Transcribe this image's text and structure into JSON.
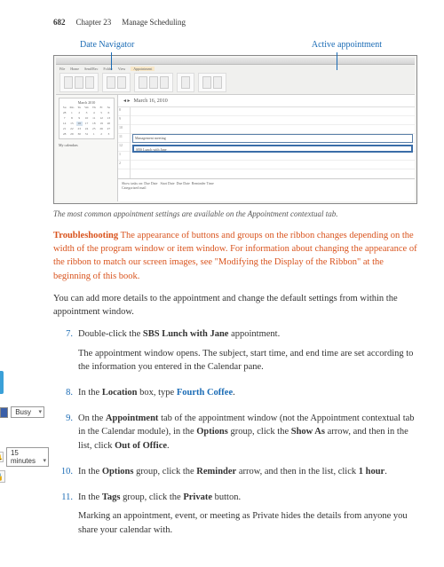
{
  "header": {
    "page_number": "682",
    "chapter": "Chapter 23",
    "title": "Manage Scheduling"
  },
  "callouts": {
    "left": "Date Navigator",
    "right": "Active appointment"
  },
  "screenshot": {
    "date_header": "March 16, 2010",
    "cal_month": "March 2010",
    "cal_days": [
      "Su",
      "Mo",
      "Tu",
      "We",
      "Th",
      "Fr",
      "Sa"
    ],
    "cal_nums": [
      "28",
      "1",
      "2",
      "3",
      "4",
      "5",
      "6",
      "7",
      "8",
      "9",
      "10",
      "11",
      "12",
      "13",
      "14",
      "15",
      "16",
      "17",
      "18",
      "19",
      "20",
      "21",
      "22",
      "23",
      "24",
      "25",
      "26",
      "27",
      "28",
      "29",
      "30",
      "31",
      "1",
      "2",
      "3"
    ],
    "my_calendars": "My calendars",
    "hours": [
      "8",
      "9",
      "10",
      "11",
      "12",
      "1",
      "2"
    ],
    "appt1": "Management meeting",
    "appt2": "SBS Lunch with Jane",
    "tasks_head": "Show tasks on: Due Date",
    "tasks_cat": "Categorized mail",
    "start_date": "Start Date",
    "due_date": "Due Date",
    "reminder": "Reminder Time"
  },
  "caption": "The most common appointment settings are available on the Appointment contextual tab.",
  "troubleshoot": {
    "lead": "Troubleshooting",
    "body": "The appearance of buttons and groups on the ribbon changes depending on the width of the program window or item window. For information about changing the appearance of the ribbon to match our screen images, see \"Modifying the Display of the Ribbon\" at the beginning of this book."
  },
  "intro_para": "You can add more details to the appointment and change the default settings from within the appointment window.",
  "steps": {
    "s7": {
      "num": "7.",
      "a": "Double-click the ",
      "b": "SBS Lunch with Jane",
      "c": " appointment.",
      "follow": "The appointment window opens. The subject, start time, and end time are set according to the information you entered in the Calendar pane."
    },
    "s8": {
      "num": "8.",
      "a": "In the ",
      "b": "Location",
      "c": " box, type ",
      "d": "Fourth Coffee",
      "e": "."
    },
    "s9": {
      "num": "9.",
      "a": "On the ",
      "b": "Appointment",
      "c": " tab of the appointment window (not the Appointment contextual tab in the Calendar module), in the ",
      "d": "Options",
      "e": " group, click the ",
      "f": "Show As",
      "g": " arrow, and then in the list, click ",
      "h": "Out of Office",
      "i": "."
    },
    "s10": {
      "num": "10.",
      "a": "In the ",
      "b": "Options",
      "c": " group, click the ",
      "d": "Reminder",
      "e": " arrow, and then in the list, click ",
      "f": "1 hour",
      "g": "."
    },
    "s11": {
      "num": "11.",
      "a": "In the ",
      "b": "Tags",
      "c": " group, click the ",
      "d": "Private",
      "e": " button.",
      "follow": "Marking an appointment, event, or meeting as Private hides the details from anyone you share your calendar with."
    }
  },
  "margin": {
    "busy": "Busy",
    "remind": "15 minutes"
  }
}
